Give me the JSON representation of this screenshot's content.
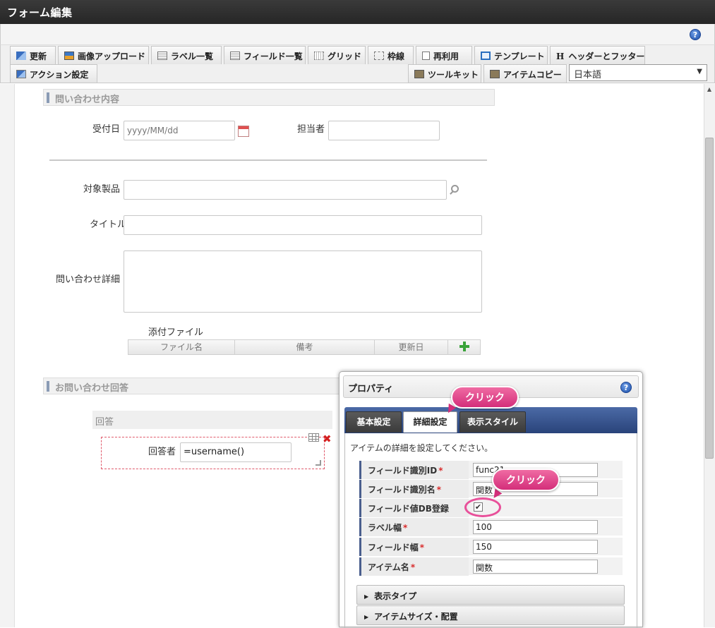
{
  "window": {
    "title": "フォーム編集"
  },
  "help": {
    "glyph": "?"
  },
  "toolbar": {
    "row1": [
      {
        "label": "更新",
        "icon": "update-icon"
      },
      {
        "label": "画像アップロード",
        "icon": "image-upload-icon"
      },
      {
        "label": "ラベル一覧",
        "icon": "label-list-icon"
      },
      {
        "label": "フィールド一覧",
        "icon": "field-list-icon"
      },
      {
        "label": "グリッド",
        "icon": "grid-icon"
      },
      {
        "label": "枠線",
        "icon": "border-icon"
      },
      {
        "label": "再利用",
        "icon": "reuse-icon"
      },
      {
        "label": "テンプレート",
        "icon": "template-icon"
      },
      {
        "label": "ヘッダーとフッター",
        "icon": "header-footer-icon"
      }
    ],
    "action_settings": "アクション設定",
    "toolkit": "ツールキット",
    "item_copy": "アイテムコピー",
    "language": "日本語"
  },
  "form": {
    "section1": "問い合わせ内容",
    "received_date_label": "受付日",
    "received_date_placeholder": "yyyy/MM/dd",
    "assignee_label": "担当者",
    "product_label": "対象製品",
    "title_label": "タイトル",
    "detail_label": "問い合わせ詳細",
    "attachment_label": "添付ファイル",
    "attachment_columns": [
      "ファイル名",
      "備考",
      "更新日"
    ],
    "section2": "お問い合わせ回答",
    "answer_group": "回答",
    "responder_label": "回答者",
    "responder_value": "=username()"
  },
  "properties": {
    "title": "プロパティ",
    "tabs": [
      "基本設定",
      "詳細設定",
      "表示スタイル"
    ],
    "active_tab": "詳細設定",
    "description": "アイテムの詳細を設定してください。",
    "rows": [
      {
        "label": "フィールド識別ID",
        "required": true,
        "value": "func21"
      },
      {
        "label": "フィールド識別名",
        "required": true,
        "value": "関数"
      },
      {
        "label": "フィールド値DB登録",
        "required": false,
        "checked": true
      },
      {
        "label": "ラベル幅",
        "required": true,
        "value": "100"
      },
      {
        "label": "フィールド幅",
        "required": true,
        "value": "150"
      },
      {
        "label": "アイテム名",
        "required": true,
        "value": "関数"
      }
    ],
    "required_mark": "*",
    "check_glyph": "✔",
    "sections": [
      "表示タイプ",
      "アイテムサイズ・配置"
    ]
  },
  "callouts": {
    "click1": "クリック",
    "click2": "クリック"
  },
  "colors": {
    "accent_pink": "#d42e7a",
    "tab_blue": "#29437a",
    "delete_red": "#d42020"
  }
}
